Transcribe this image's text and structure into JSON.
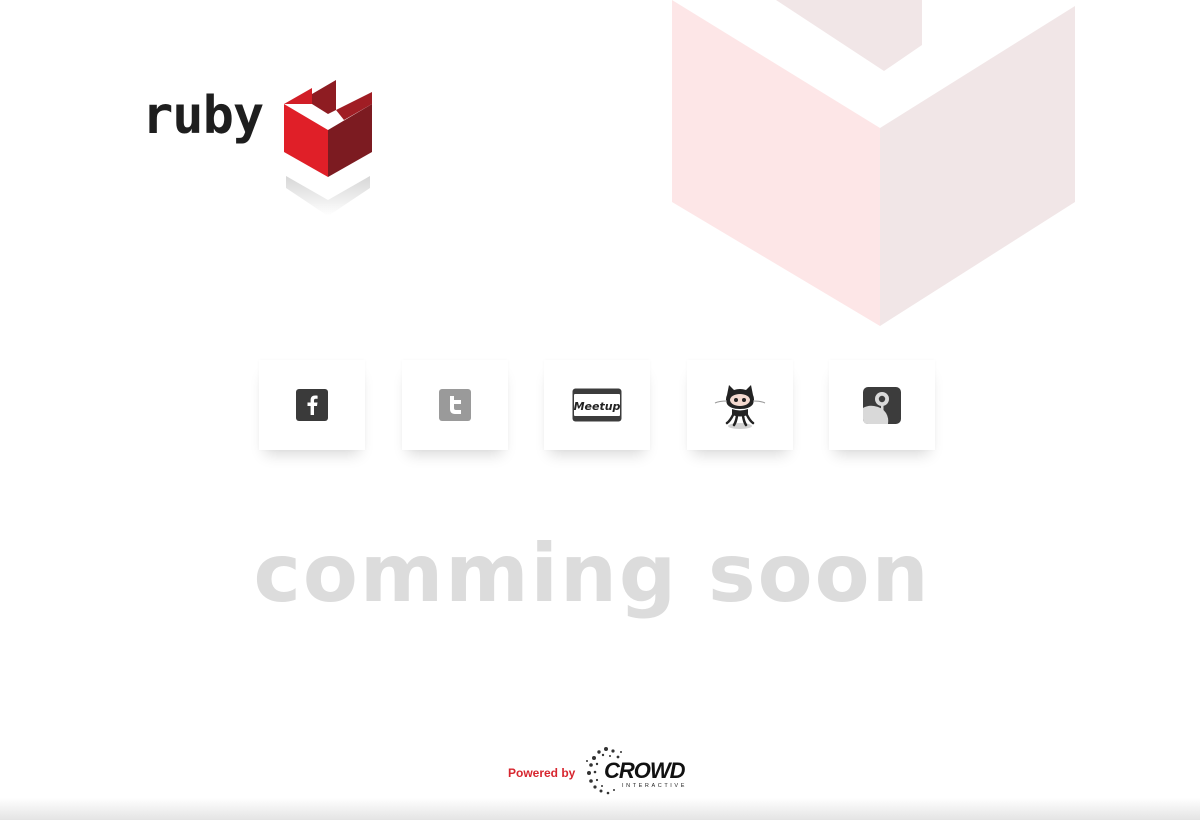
{
  "brand": {
    "logo_text": "ruby",
    "accent_color": "#d8232c",
    "dark_red": "#7f1c22"
  },
  "social": {
    "items": [
      {
        "name": "facebook",
        "icon": "facebook-icon",
        "glyph": "f"
      },
      {
        "name": "twitter",
        "icon": "twitter-icon",
        "glyph": "t"
      },
      {
        "name": "meetup",
        "icon": "meetup-icon",
        "glyph": "Meetup"
      },
      {
        "name": "github",
        "icon": "github-octocat-icon"
      },
      {
        "name": "google-plus",
        "icon": "google-plus-icon",
        "glyph": "g"
      }
    ]
  },
  "headline": "comming soon",
  "footer": {
    "powered_label": "Powered by",
    "crowd_logo_text": "CROWD",
    "crowd_logo_subtext": "INTERACTIVE"
  }
}
